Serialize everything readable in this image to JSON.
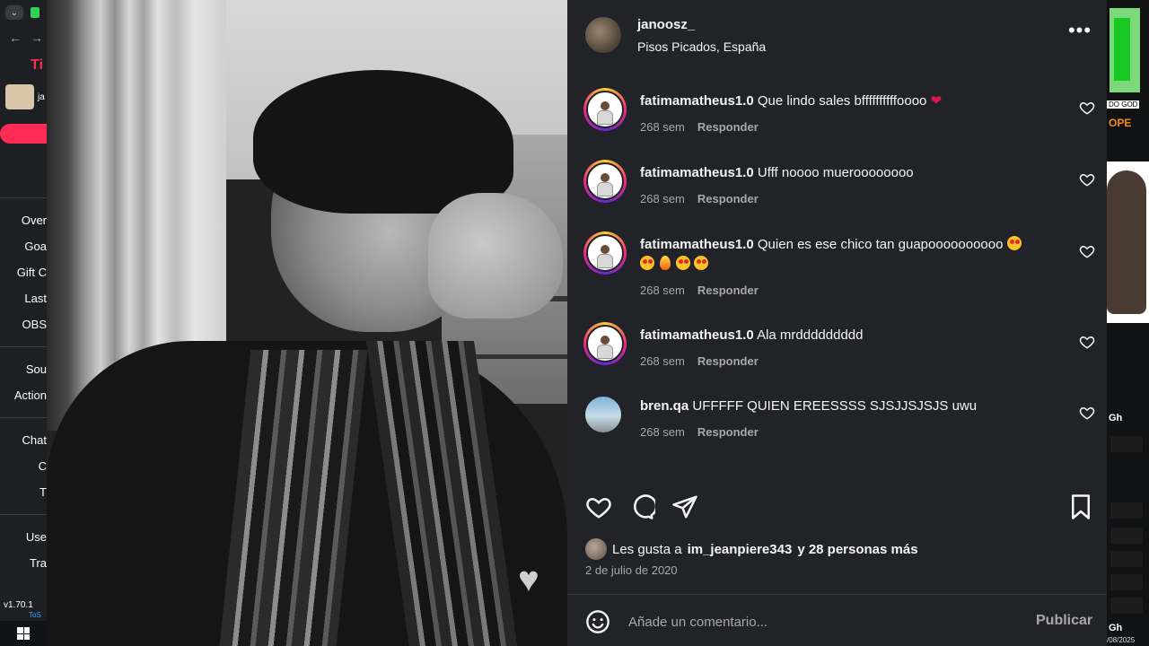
{
  "left_app": {
    "brand": "Ti",
    "avatar_initial": "ja",
    "menu_items": [
      "Over",
      "Goa",
      "Gift C",
      "Last",
      "OBS"
    ],
    "menu_items_2": [
      "Sou",
      "Action"
    ],
    "menu_items_3": [
      "Chat",
      "C",
      "T"
    ],
    "menu_items_4": [
      "Use",
      "Tra"
    ],
    "version": "v1.70.1",
    "tos": "ToS"
  },
  "right_app": {
    "god_text": "DO GOD",
    "ope_text": "OPE",
    "gh1": "Gh",
    "gh2": "Gh",
    "date": "/08/2025"
  },
  "post": {
    "username": "janoosz_",
    "location": "Pisos Picados, España",
    "comments": [
      {
        "user": "fatimamatheus1.0",
        "text": "Que lindo sales bffffffffffoooo",
        "time": "268 sem",
        "reply": "Responder",
        "trail": "red-heart"
      },
      {
        "user": "fatimamatheus1.0",
        "text": "Ufff noooo mueroooooooo",
        "time": "268 sem",
        "reply": "Responder"
      },
      {
        "user": "fatimamatheus1.0",
        "text": "Quien es ese chico tan guapoooooooooo",
        "time": "268 sem",
        "reply": "Responder"
      },
      {
        "user": "fatimamatheus1.0",
        "text": "Ala mrddddddddd",
        "time": "268 sem",
        "reply": "Responder"
      },
      {
        "user": "bren.qa",
        "text": "UFFFFF QUIEN EREESSSS SJSJJSJSJS uwu",
        "time": "268 sem",
        "reply": "Responder"
      }
    ],
    "likes_prefix": "Les gusta a",
    "likes_user": "im_jeanpiere343",
    "likes_suffix": "y 28 personas más",
    "date": "2 de julio de 2020",
    "comment_placeholder": "Añade un comentario...",
    "publish_label": "Publicar"
  }
}
